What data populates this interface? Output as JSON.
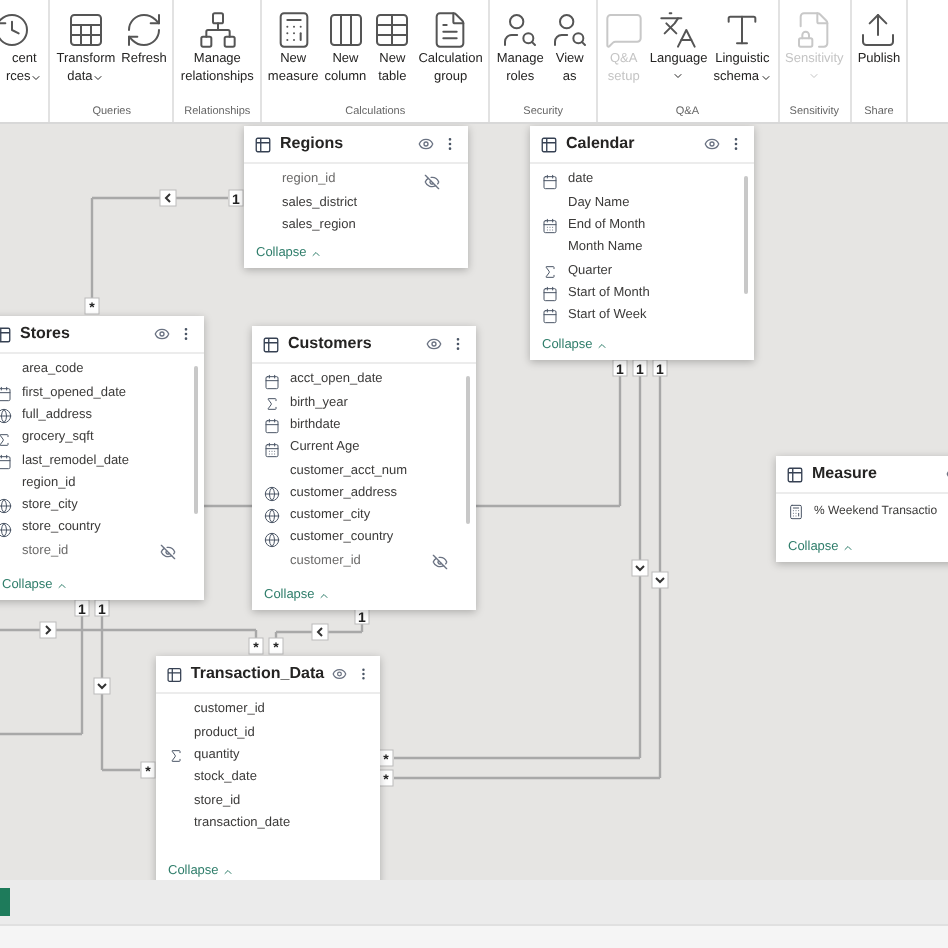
{
  "ribbon": {
    "groups": [
      {
        "buttons": [
          {
            "lines": [
              "cent",
              "rces"
            ],
            "menu": true,
            "disabled": false
          }
        ]
      },
      {
        "label": "Queries",
        "buttons": [
          {
            "lines": [
              "Transform",
              "data"
            ],
            "menu": true,
            "disabled": false
          },
          {
            "lines": [
              "Refresh"
            ],
            "menu": false,
            "disabled": false
          }
        ]
      },
      {
        "label": "Relationships",
        "buttons": [
          {
            "lines": [
              "Manage",
              "relationships"
            ],
            "menu": false,
            "disabled": false
          }
        ]
      },
      {
        "label": "Calculations",
        "buttons": [
          {
            "lines": [
              "New",
              "measure"
            ],
            "menu": false,
            "disabled": false
          },
          {
            "lines": [
              "New",
              "column"
            ],
            "menu": false,
            "disabled": false
          },
          {
            "lines": [
              "New",
              "table"
            ],
            "menu": false,
            "disabled": false
          },
          {
            "lines": [
              "Calculation",
              "group"
            ],
            "menu": false,
            "disabled": false
          }
        ]
      },
      {
        "label": "Security",
        "buttons": [
          {
            "lines": [
              "Manage",
              "roles"
            ],
            "menu": false,
            "disabled": false
          },
          {
            "lines": [
              "View",
              "as"
            ],
            "menu": false,
            "disabled": false
          }
        ]
      },
      {
        "label": "Q&A",
        "buttons": [
          {
            "lines": [
              "Q&A",
              "setup"
            ],
            "menu": false,
            "disabled": true
          },
          {
            "lines": [
              "Language"
            ],
            "menu": true,
            "disabled": false
          },
          {
            "lines": [
              "Linguistic",
              "schema"
            ],
            "menu": true,
            "disabled": false
          }
        ]
      },
      {
        "label": "Sensitivity",
        "buttons": [
          {
            "lines": [
              "Sensitivity"
            ],
            "menu": true,
            "disabled": true
          }
        ]
      },
      {
        "label": "Share",
        "buttons": [
          {
            "lines": [
              "Publish"
            ],
            "menu": false,
            "disabled": false
          }
        ]
      }
    ]
  },
  "tables": [
    {
      "name": "Regions",
      "fields": [
        {
          "name": "region_id",
          "kind": "text",
          "hidden": true
        },
        {
          "name": "sales_district",
          "kind": "text",
          "hidden": false
        },
        {
          "name": "sales_region",
          "kind": "text",
          "hidden": false
        }
      ],
      "collapse": "Collapse"
    },
    {
      "name": "Calendar",
      "fields": [
        {
          "name": "date",
          "kind": "date",
          "hidden": false
        },
        {
          "name": "Day Name",
          "kind": "text",
          "hidden": false
        },
        {
          "name": "End of Month",
          "kind": "calc_date",
          "hidden": false
        },
        {
          "name": "Month Name",
          "kind": "text",
          "hidden": false
        },
        {
          "name": "Quarter",
          "kind": "sum",
          "hidden": false
        },
        {
          "name": "Start of Month",
          "kind": "date",
          "hidden": false
        },
        {
          "name": "Start of Week",
          "kind": "date",
          "hidden": false
        }
      ],
      "collapse": "Collapse"
    },
    {
      "name": "Stores",
      "fields": [
        {
          "name": "area_code",
          "kind": "text",
          "hidden": false
        },
        {
          "name": "first_opened_date",
          "kind": "date",
          "hidden": false
        },
        {
          "name": "full_address",
          "kind": "geo",
          "hidden": false
        },
        {
          "name": "grocery_sqft",
          "kind": "sum",
          "hidden": false
        },
        {
          "name": "last_remodel_date",
          "kind": "date",
          "hidden": false
        },
        {
          "name": "region_id",
          "kind": "text",
          "hidden": false
        },
        {
          "name": "store_city",
          "kind": "geo",
          "hidden": false
        },
        {
          "name": "store_country",
          "kind": "geo",
          "hidden": false
        },
        {
          "name": "store_id",
          "kind": "text",
          "hidden": true
        }
      ],
      "collapse": "Collapse"
    },
    {
      "name": "Customers",
      "fields": [
        {
          "name": "acct_open_date",
          "kind": "date",
          "hidden": false
        },
        {
          "name": "birth_year",
          "kind": "sum",
          "hidden": false
        },
        {
          "name": "birthdate",
          "kind": "date",
          "hidden": false
        },
        {
          "name": "Current Age",
          "kind": "calc_date",
          "hidden": false
        },
        {
          "name": "customer_acct_num",
          "kind": "text",
          "hidden": false
        },
        {
          "name": "customer_address",
          "kind": "geo",
          "hidden": false
        },
        {
          "name": "customer_city",
          "kind": "geo",
          "hidden": false
        },
        {
          "name": "customer_country",
          "kind": "geo",
          "hidden": false
        },
        {
          "name": "customer_id",
          "kind": "text",
          "hidden": true
        }
      ],
      "collapse": "Collapse"
    },
    {
      "name": "Measure",
      "fields": [
        {
          "name": "% Weekend Transactio",
          "kind": "measure",
          "hidden": false
        }
      ],
      "collapse": "Collapse"
    },
    {
      "name": "Transaction_Data",
      "fields": [
        {
          "name": "customer_id",
          "kind": "text",
          "hidden": false
        },
        {
          "name": "product_id",
          "kind": "text",
          "hidden": false
        },
        {
          "name": "quantity",
          "kind": "sum",
          "hidden": false
        },
        {
          "name": "stock_date",
          "kind": "text",
          "hidden": false
        },
        {
          "name": "store_id",
          "kind": "text",
          "hidden": false
        },
        {
          "name": "transaction_date",
          "kind": "text",
          "hidden": false
        }
      ],
      "collapse": "Collapse"
    }
  ],
  "relationships": [
    {
      "ends": [
        "1",
        "*"
      ]
    },
    {
      "ends": [
        "1"
      ]
    },
    {
      "ends": [
        "1",
        "*"
      ]
    },
    {
      "ends": [
        "1",
        "*"
      ]
    },
    {
      "ends": [
        "1"
      ]
    },
    {
      "ends": [
        "1",
        "*"
      ]
    },
    {
      "ends": [
        "*"
      ]
    },
    {
      "ends": [
        "1",
        "*"
      ]
    }
  ]
}
